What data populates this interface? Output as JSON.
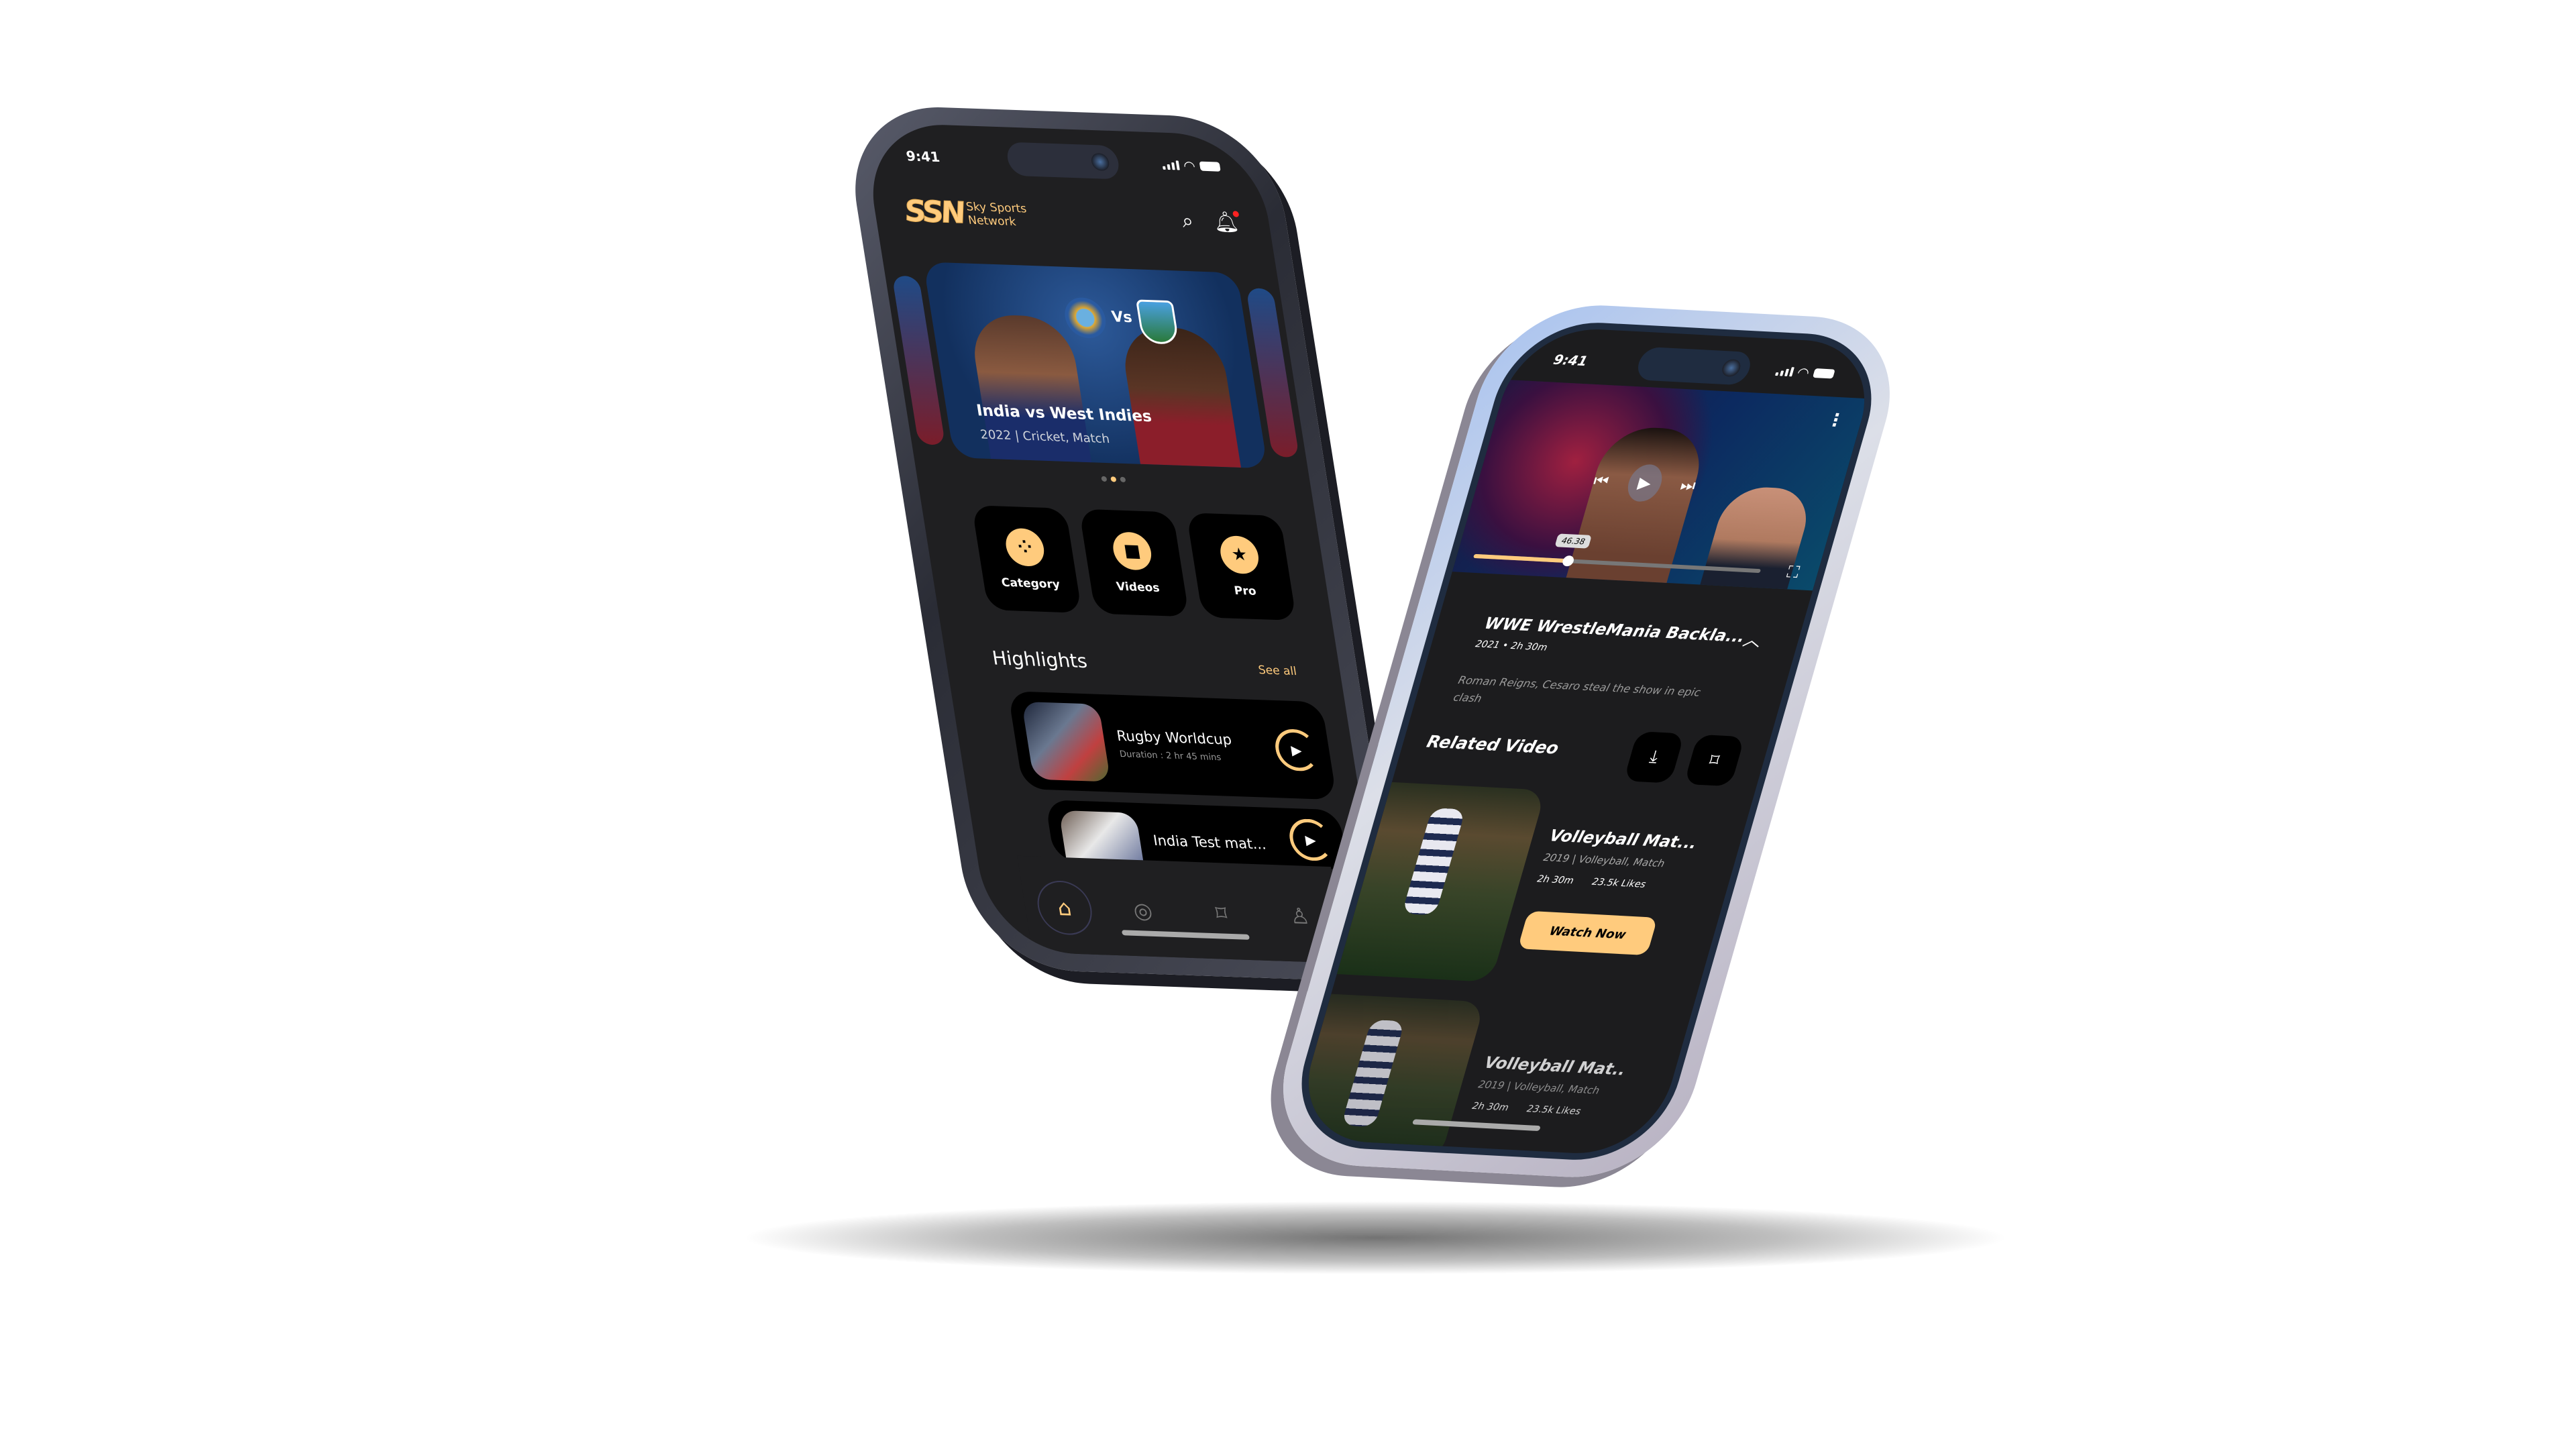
{
  "home": {
    "time": "9:41",
    "brand": {
      "mark": "SSN",
      "line1": "Sky Sports",
      "line2": "Network"
    },
    "featured": {
      "title": "India vs West Indies",
      "meta": "2022 | Cricket, Match",
      "vs": "Vs"
    },
    "carousel_dots": 3,
    "carousel_active": 2,
    "quick_links": [
      {
        "label": "Category",
        "icon": "grid-icon",
        "glyph": "⁘"
      },
      {
        "label": "Videos",
        "icon": "video-camera-icon",
        "glyph": "■"
      },
      {
        "label": "Pro",
        "icon": "pro-star-icon",
        "glyph": "★"
      }
    ],
    "highlights": {
      "title": "Highlights",
      "see_all": "See all",
      "items": [
        {
          "title": "Rugby Worldcup",
          "duration": "Duration : 2 hr 45 mins"
        },
        {
          "title": "India Test mat..."
        }
      ]
    },
    "nav": [
      {
        "name": "home",
        "glyph": "⌂"
      },
      {
        "name": "explore",
        "glyph": "◎"
      },
      {
        "name": "bookmark",
        "glyph": "⌑"
      },
      {
        "name": "profile",
        "glyph": "♙"
      }
    ]
  },
  "detail": {
    "time": "9:41",
    "player": {
      "timestamp": "46.38",
      "progress": 0.33
    },
    "title": "WWE WrestleMania Backla...",
    "meta": "2021 • 2h 30m",
    "description": "Roman Reigns, Cesaro steal the show in epic clash",
    "related_title": "Related Video",
    "related": [
      {
        "title": "Volleyball Mat...",
        "meta": "2019  |  Volleyball, Match",
        "duration": "2h 30m",
        "likes": "23.5k Likes",
        "cta": "Watch Now"
      },
      {
        "title": "Volleyball Mat..",
        "meta": "2019  |  Volleyball, Match",
        "duration": "2h 30m",
        "likes": "23.5k Likes"
      }
    ]
  },
  "colors": {
    "accent": "#ffcb7d",
    "screen": "#1f1f21",
    "card": "#000000"
  }
}
